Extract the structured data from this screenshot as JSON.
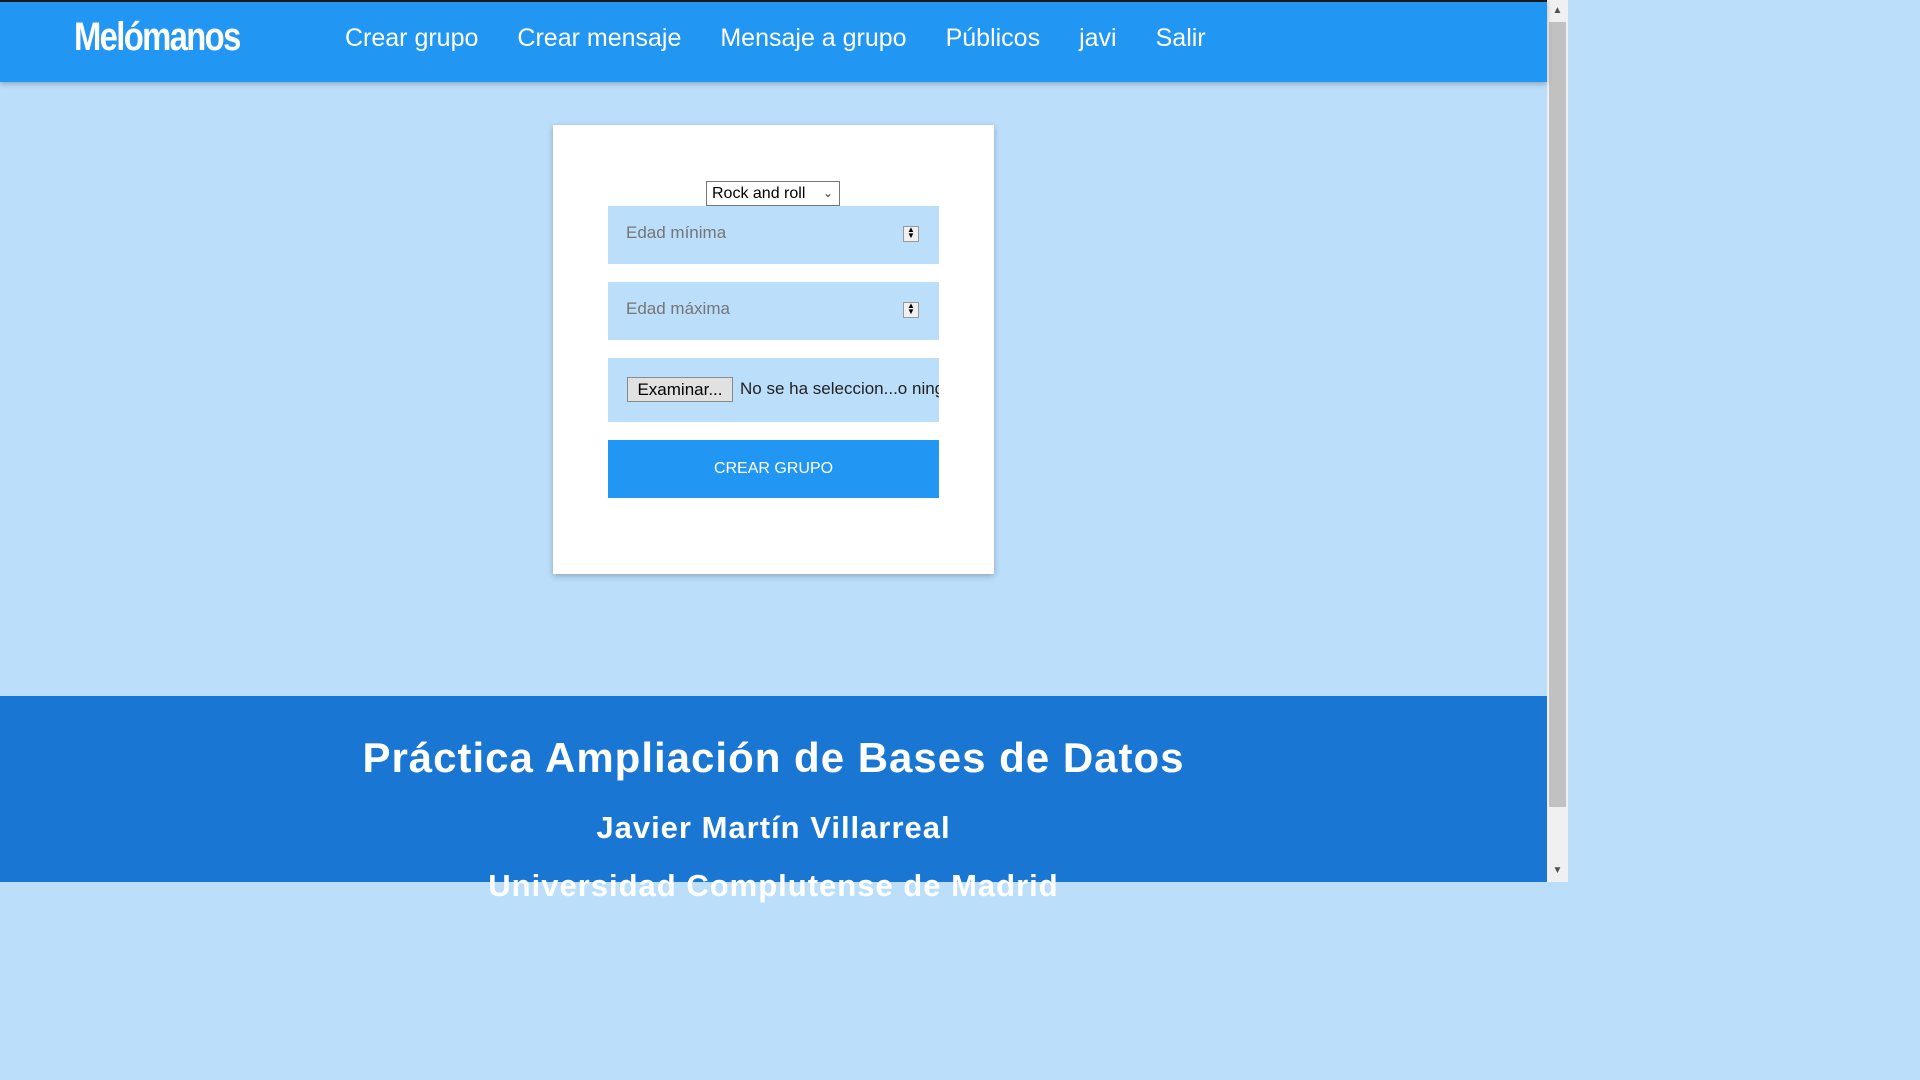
{
  "header": {
    "brand": "Melómanos",
    "nav": [
      {
        "label": "Crear grupo"
      },
      {
        "label": "Crear mensaje"
      },
      {
        "label": "Mensaje a grupo"
      },
      {
        "label": "Públicos"
      },
      {
        "label": "javi"
      },
      {
        "label": "Salir"
      }
    ]
  },
  "form": {
    "genre_selected": "Rock and roll",
    "min_age_placeholder": "Edad mínima",
    "max_age_placeholder": "Edad máxima",
    "file_button": "Examinar...",
    "file_status": "No se ha seleccion...o ning",
    "submit_label": "CREAR GRUPO"
  },
  "footer": {
    "title": "Práctica Ampliación de Bases de Datos",
    "author": "Javier Martín Villarreal",
    "institution": "Universidad Complutense de Madrid"
  },
  "icons": {
    "select": "chevron-down-icon",
    "spinner": "spinner-arrows-icon",
    "scroll_up": "arrow-up-icon",
    "scroll_down": "arrow-down-icon"
  },
  "colors": {
    "header_bg": "#2196f3",
    "page_bg": "#bbdefb",
    "footer_bg": "#1976d2",
    "button_bg": "#2196f3"
  }
}
